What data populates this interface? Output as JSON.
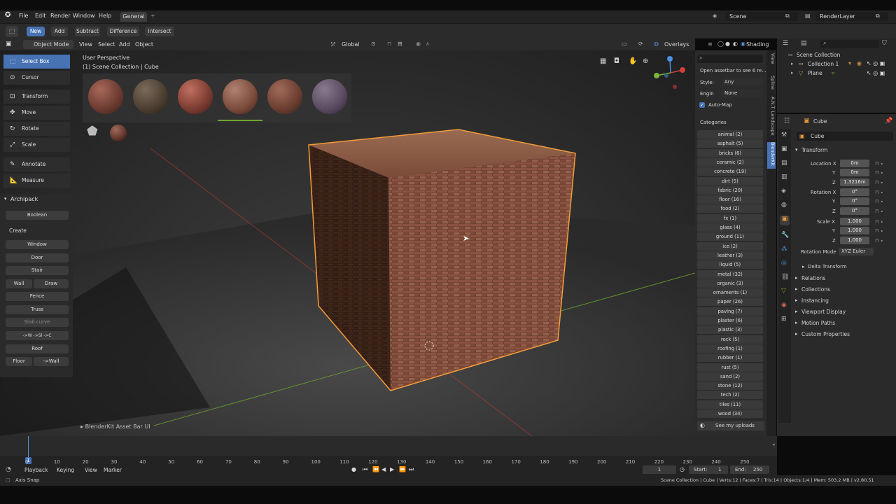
{
  "topbar": {
    "menus": [
      "File",
      "Edit",
      "Render",
      "Window",
      "Help"
    ],
    "workspace_tab": "General",
    "add_tab": "+",
    "scene_label": "Scene",
    "view_layer": "RenderLayer"
  },
  "tool_header": {
    "modes": [
      "New",
      "Add",
      "Subtract",
      "Difference",
      "Intersect"
    ]
  },
  "viewport_header": {
    "mode": "Object Mode",
    "menus": [
      "View",
      "Select",
      "Add",
      "Object"
    ],
    "transform": "Global",
    "overlays": "Overlays",
    "shading": "Shading"
  },
  "viewport": {
    "perspective_label": "User Perspective",
    "collection_label": "(1) Scene Collection | Cube",
    "asset_bar_label": "BlenderKit Asset Bar UI"
  },
  "toolbar": {
    "items": [
      "Select Box",
      "Cursor",
      "Transform",
      "Move",
      "Rotate",
      "Scale",
      "Annotate",
      "Measure"
    ]
  },
  "archipack": {
    "title": "Archipack",
    "boolean": "Boolean",
    "create_label": "Create",
    "window": "Window",
    "door": "Door",
    "stair": "Stair",
    "wall": "Wall",
    "draw": "Draw",
    "fence": "Fence",
    "truss": "Truss",
    "slab": "Slab curve",
    "wall_shortcuts": "->W ->Sl ->C",
    "roof": "Roof",
    "floor": "Floor",
    "floor_wall": "->Wall"
  },
  "blenderkit": {
    "search_hint": "Open assetbar to see 6 re...",
    "style_label": "Style:",
    "style_value": "Any",
    "engine_label": "Engin",
    "engine_value": "None",
    "automap": "Auto-Map",
    "categories_title": "Categories",
    "categories": [
      "animal (2)",
      "asphalt (5)",
      "bricks (6)",
      "ceramic (2)",
      "concrete (19)",
      "dirt (5)",
      "fabric (20)",
      "floor (16)",
      "food (2)",
      "fx (1)",
      "glass (4)",
      "ground (11)",
      "ice (2)",
      "leather (3)",
      "liquid (5)",
      "metal (32)",
      "organic (3)",
      "ornaments (1)",
      "paper (26)",
      "paving (7)",
      "plaster (6)",
      "plastic (3)",
      "rock (5)",
      "roofing (1)",
      "rubber (1)",
      "rust (5)",
      "sand (2)",
      "stone (12)",
      "tech (2)",
      "tiles (11)",
      "wood (34)"
    ],
    "uploads": "See my uploads"
  },
  "side_tabs": [
    "View",
    "Spline",
    "A.N.T. Landscape",
    "BlenderKit"
  ],
  "outliner": {
    "title": "Scene Collection",
    "collection": "Collection 1",
    "plane": "Plane"
  },
  "properties": {
    "object_name": "Cube",
    "data_name": "Cube",
    "transform_title": "Transform",
    "location_label": "Location X",
    "location": [
      "0m",
      "0m",
      "1.3216m"
    ],
    "rotation_label": "Rotation X",
    "rotation": [
      "0°",
      "0°",
      "0°"
    ],
    "scale_label": "Scale X",
    "scale": [
      "1.000",
      "1.000",
      "1.000"
    ],
    "y_label": "Y",
    "z_label": "Z",
    "rotation_mode_label": "Rotation Mode",
    "rotation_mode": "XYZ Euler",
    "delta": "Delta Transform",
    "sections": [
      "Relations",
      "Collections",
      "Instancing",
      "Viewport Display",
      "Motion Paths",
      "Custom Properties"
    ]
  },
  "timeline": {
    "ticks": [
      "0",
      "10",
      "20",
      "30",
      "40",
      "50",
      "60",
      "70",
      "80",
      "90",
      "100",
      "110",
      "120",
      "130",
      "140",
      "150",
      "160",
      "170",
      "180",
      "190",
      "200",
      "210",
      "220",
      "230",
      "240",
      "250"
    ],
    "playback": "Playback",
    "keying": "Keying",
    "view": "View",
    "marker": "Marker",
    "current_frame": "1",
    "start_label": "Start:",
    "start": "1",
    "end_label": "End:",
    "end": "250"
  },
  "status": {
    "left": "Axis Snap",
    "right": "Scene Collection | Cube | Verts:12 | Faces:7 | Tris:14 | Objects:1/4 | Mem: 503.2 MB | v2.80.51"
  },
  "colors": {
    "accent": "#4772b3",
    "selection_outline": "#f39c3a",
    "x_axis": "#c0392b",
    "y_axis": "#6ea62f"
  }
}
